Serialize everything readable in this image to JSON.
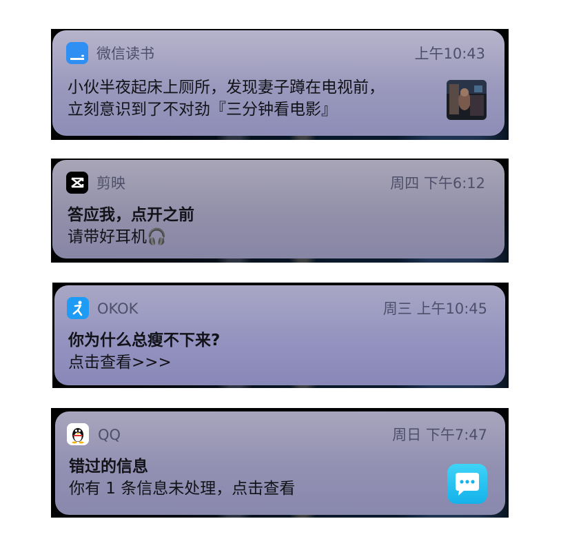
{
  "notifications": [
    {
      "app": "微信读书",
      "icon": "weread-icon",
      "time": "上午10:43",
      "line1": "小伙半夜起床上厕所，发现妻子蹲在电视前，",
      "line2": "立刻意识到了不对劲『三分钟看电影』",
      "has_thumbnail": true
    },
    {
      "app": "剪映",
      "icon": "capcut-icon",
      "time": "周四 下午6:12",
      "line1": "答应我，点开之前",
      "line2": "请带好耳机🎧"
    },
    {
      "app": "OKOK",
      "icon": "okok-icon",
      "time": "周三 上午10:45",
      "line1": "你为什么总瘦不下来?",
      "line2": "点击查看>>>"
    },
    {
      "app": "QQ",
      "icon": "qq-penguin-icon",
      "time": "周日 下午7:47",
      "line1": "错过的信息",
      "line2": "你有 1 条信息未处理，点击查看",
      "has_chat_icon": true
    }
  ],
  "colors": {
    "card_top": "#b2b0c8",
    "card_bottom": "#8c8cb6",
    "weread_blue": "#2f8ff2",
    "okok_blue": "#1e9cf5",
    "chat_cyan": "#1fc3f2"
  }
}
